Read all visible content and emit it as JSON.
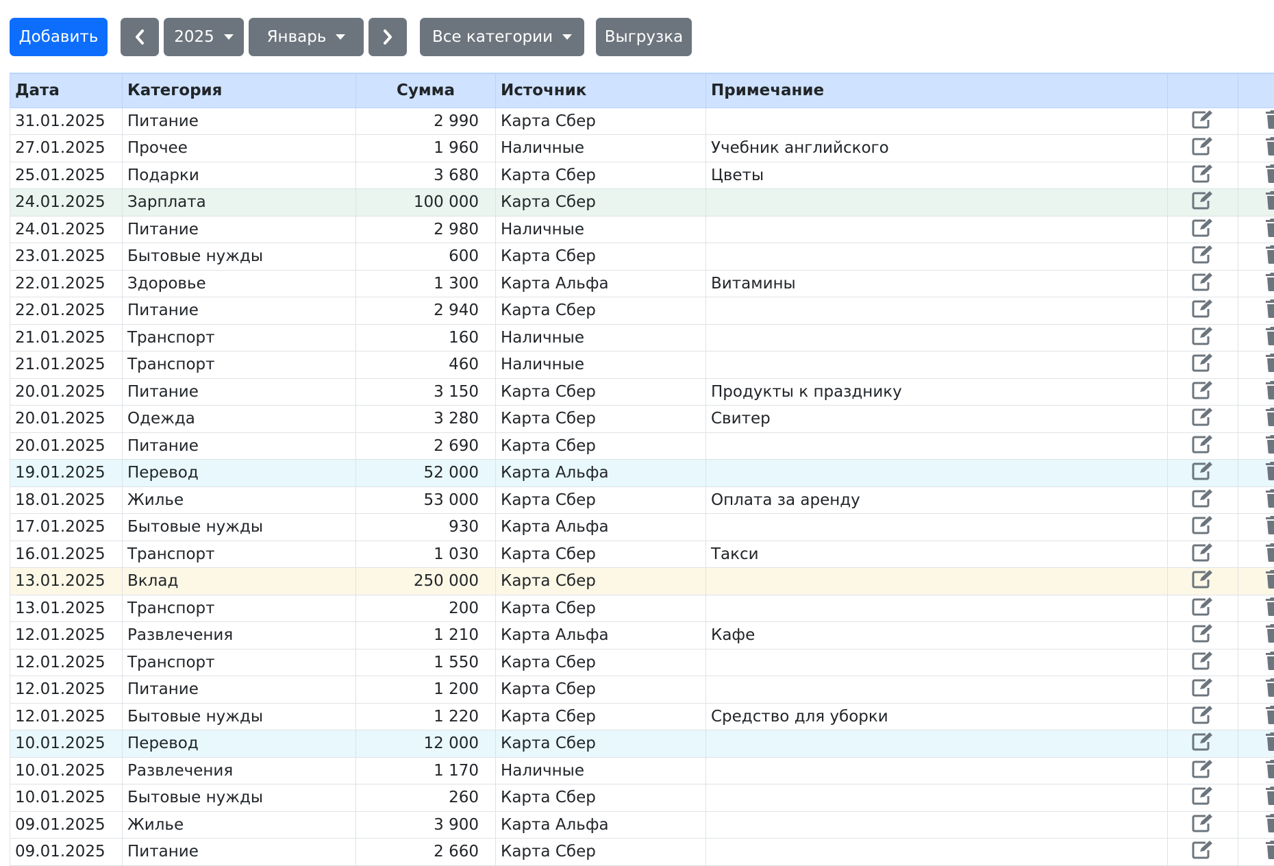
{
  "toolbar": {
    "add_label": "Добавить",
    "year_label": "2025",
    "month_label": "Январь",
    "category_label": "Все категории",
    "export_label": "Выгрузка"
  },
  "columns": {
    "date": "Дата",
    "category": "Категория",
    "amount": "Сумма",
    "source": "Источник",
    "note": "Примечание"
  },
  "icons": {
    "edit": "edit-icon",
    "delete": "trash-icon",
    "prev": "chevron-left-icon",
    "next": "chevron-right-icon"
  },
  "colors": {
    "primary": "#0d6efd",
    "secondary": "#6c757d",
    "header_bg": "#cfe2ff",
    "income_bg": "#e9f5ee",
    "transfer_bg": "#e8f8fc",
    "deposit_bg": "#fdf8e6"
  },
  "rows": [
    {
      "date": "31.01.2025",
      "category": "Питание",
      "amount": "2 990",
      "source": "Карта Сбер",
      "note": "",
      "type": ""
    },
    {
      "date": "27.01.2025",
      "category": "Прочее",
      "amount": "1 960",
      "source": "Наличные",
      "note": "Учебник английского",
      "type": ""
    },
    {
      "date": "25.01.2025",
      "category": "Подарки",
      "amount": "3 680",
      "source": "Карта Сбер",
      "note": "Цветы",
      "type": ""
    },
    {
      "date": "24.01.2025",
      "category": "Зарплата",
      "amount": "100 000",
      "source": "Карта Сбер",
      "note": "",
      "type": "income"
    },
    {
      "date": "24.01.2025",
      "category": "Питание",
      "amount": "2 980",
      "source": "Наличные",
      "note": "",
      "type": ""
    },
    {
      "date": "23.01.2025",
      "category": "Бытовые нужды",
      "amount": "600",
      "source": "Карта Сбер",
      "note": "",
      "type": ""
    },
    {
      "date": "22.01.2025",
      "category": "Здоровье",
      "amount": "1 300",
      "source": "Карта Альфа",
      "note": "Витамины",
      "type": ""
    },
    {
      "date": "22.01.2025",
      "category": "Питание",
      "amount": "2 940",
      "source": "Карта Сбер",
      "note": "",
      "type": ""
    },
    {
      "date": "21.01.2025",
      "category": "Транспорт",
      "amount": "160",
      "source": "Наличные",
      "note": "",
      "type": ""
    },
    {
      "date": "21.01.2025",
      "category": "Транспорт",
      "amount": "460",
      "source": "Наличные",
      "note": "",
      "type": ""
    },
    {
      "date": "20.01.2025",
      "category": "Питание",
      "amount": "3 150",
      "source": "Карта Сбер",
      "note": "Продукты к празднику",
      "type": ""
    },
    {
      "date": "20.01.2025",
      "category": "Одежда",
      "amount": "3 280",
      "source": "Карта Сбер",
      "note": "Свитер",
      "type": ""
    },
    {
      "date": "20.01.2025",
      "category": "Питание",
      "amount": "2 690",
      "source": "Карта Сбер",
      "note": "",
      "type": ""
    },
    {
      "date": "19.01.2025",
      "category": "Перевод",
      "amount": "52 000",
      "source": "Карта Альфа",
      "note": "",
      "type": "transfer"
    },
    {
      "date": "18.01.2025",
      "category": "Жилье",
      "amount": "53 000",
      "source": "Карта Сбер",
      "note": "Оплата за аренду",
      "type": ""
    },
    {
      "date": "17.01.2025",
      "category": "Бытовые нужды",
      "amount": "930",
      "source": "Карта Альфа",
      "note": "",
      "type": ""
    },
    {
      "date": "16.01.2025",
      "category": "Транспорт",
      "amount": "1 030",
      "source": "Карта Сбер",
      "note": "Такси",
      "type": ""
    },
    {
      "date": "13.01.2025",
      "category": "Вклад",
      "amount": "250 000",
      "source": "Карта Сбер",
      "note": "",
      "type": "deposit"
    },
    {
      "date": "13.01.2025",
      "category": "Транспорт",
      "amount": "200",
      "source": "Карта Сбер",
      "note": "",
      "type": ""
    },
    {
      "date": "12.01.2025",
      "category": "Развлечения",
      "amount": "1 210",
      "source": "Карта Альфа",
      "note": "Кафе",
      "type": ""
    },
    {
      "date": "12.01.2025",
      "category": "Транспорт",
      "amount": "1 550",
      "source": "Карта Сбер",
      "note": "",
      "type": ""
    },
    {
      "date": "12.01.2025",
      "category": "Питание",
      "amount": "1 200",
      "source": "Карта Сбер",
      "note": "",
      "type": ""
    },
    {
      "date": "12.01.2025",
      "category": "Бытовые нужды",
      "amount": "1 220",
      "source": "Карта Сбер",
      "note": "Средство для уборки",
      "type": ""
    },
    {
      "date": "10.01.2025",
      "category": "Перевод",
      "amount": "12 000",
      "source": "Карта Сбер",
      "note": "",
      "type": "transfer"
    },
    {
      "date": "10.01.2025",
      "category": "Развлечения",
      "amount": "1 170",
      "source": "Наличные",
      "note": "",
      "type": ""
    },
    {
      "date": "10.01.2025",
      "category": "Бытовые нужды",
      "amount": "260",
      "source": "Карта Сбер",
      "note": "",
      "type": ""
    },
    {
      "date": "09.01.2025",
      "category": "Жилье",
      "amount": "3 900",
      "source": "Карта Альфа",
      "note": "",
      "type": ""
    },
    {
      "date": "09.01.2025",
      "category": "Питание",
      "amount": "2 660",
      "source": "Карта Сбер",
      "note": "",
      "type": ""
    }
  ]
}
